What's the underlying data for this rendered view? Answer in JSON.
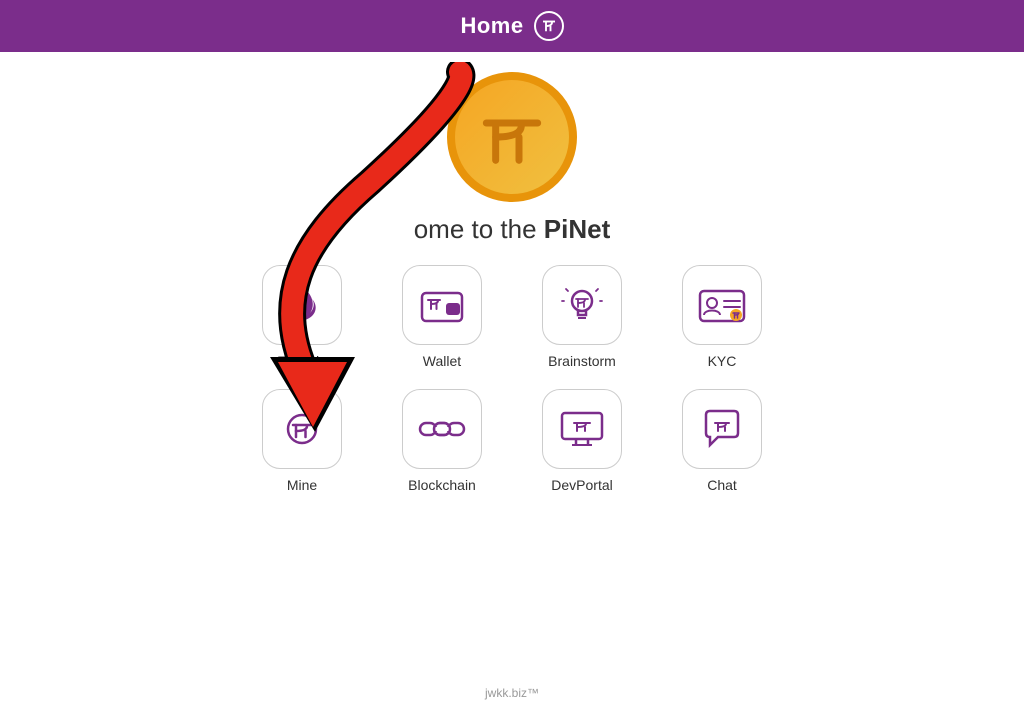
{
  "header": {
    "title": "Home",
    "icon_label": "π"
  },
  "welcome": {
    "text_prefix": "ome to the ",
    "brand": "PiNet"
  },
  "apps": {
    "row1": [
      {
        "id": "fireside",
        "label": "Fireside"
      },
      {
        "id": "wallet",
        "label": "Wallet"
      },
      {
        "id": "brainstorm",
        "label": "Brainstorm"
      },
      {
        "id": "kyc",
        "label": "KYC"
      }
    ],
    "row2": [
      {
        "id": "mine",
        "label": "Mine"
      },
      {
        "id": "blockchain",
        "label": "Blockchain"
      },
      {
        "id": "devportal",
        "label": "DevPortal"
      },
      {
        "id": "chat",
        "label": "Chat"
      }
    ]
  },
  "footer": {
    "text": "jwkk.biz™"
  }
}
